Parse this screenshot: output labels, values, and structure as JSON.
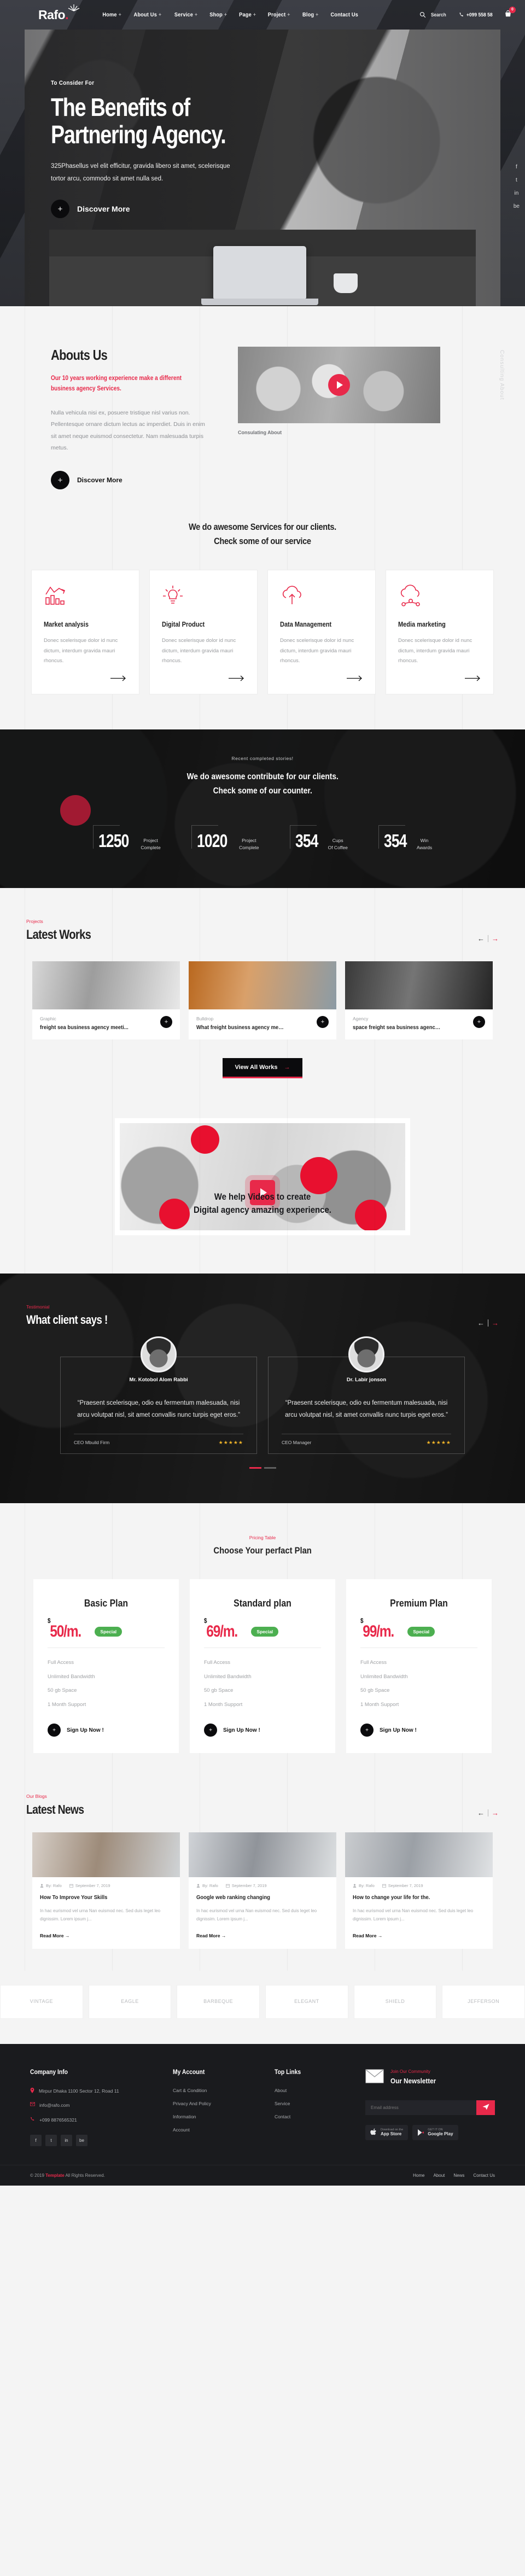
{
  "brand": {
    "name": "Rafo",
    "dot": ".",
    "accent": "#e8294a"
  },
  "header": {
    "nav": [
      {
        "label": "Home",
        "caret": "+"
      },
      {
        "label": "About Us",
        "caret": "+"
      },
      {
        "label": "Service",
        "caret": "+"
      },
      {
        "label": "Shop",
        "caret": "+"
      },
      {
        "label": "Page",
        "caret": "+"
      },
      {
        "label": "Project",
        "caret": "+"
      },
      {
        "label": "Blog",
        "caret": "+"
      },
      {
        "label": "Contact Us",
        "caret": ""
      }
    ],
    "search_label": "Search",
    "search_placeholder": "Search",
    "phone": "+099 558 58",
    "cart_count": "0",
    "side_links": [
      "f",
      "t",
      "in",
      "be"
    ]
  },
  "hero": {
    "subtitle": "To Consider For",
    "title_line1": "The Benefits of",
    "title_line2": "Partnering Agency.",
    "text": "325Phasellus vel elit efficitur, gravida libero sit amet, scelerisque tortor arcu, commodo sit amet nulla sed.",
    "cta": "Discover More",
    "cta_icon": "+"
  },
  "about": {
    "title": "Abouts Us",
    "tagline": "Our 10 years working experience make a different business agency Services.",
    "paragraph": "Nulla vehicula nisi ex, posuere tristique nisl varius non. Pellentesque ornare dictum lectus ac imperdiet. Duis in enim sit amet neque euismod consectetur. Nam malesuada turpis metus.",
    "cta": "Discover More",
    "cta_icon": "+",
    "video_caption": "Consulating About",
    "watermark": "Consulting About"
  },
  "services": {
    "heading_line1": "We do awesome Services for our clients.",
    "heading_line2": "Check some of our service",
    "cards": [
      {
        "icon": "bar-chart-icon",
        "title": "Market analysis",
        "text": "Donec scelerisque dolor id nunc dictum, interdum gravida mauri rhoncus."
      },
      {
        "icon": "lightbulb-icon",
        "title": "Digital Product",
        "text": "Donec scelerisque dolor id nunc dictum, interdum gravida mauri rhoncus."
      },
      {
        "icon": "cloud-upload-icon",
        "title": "Data Management",
        "text": "Donec scelerisque dolor id nunc dictum, interdum gravida mauri rhoncus."
      },
      {
        "icon": "cloud-network-icon",
        "title": "Media marketing",
        "text": "Donec scelerisque dolor id nunc dictum, interdum gravida mauri rhoncus."
      }
    ]
  },
  "counter": {
    "eyebrow": "Recent completed stories!",
    "heading_line1": "We do awesome contribute for our clients.",
    "heading_line2": "Check some of our counter.",
    "items": [
      {
        "value": "1250",
        "label_line1": "Project",
        "label_line2": "Complete"
      },
      {
        "value": "1020",
        "label_line1": "Project",
        "label_line2": "Complete"
      },
      {
        "value": "354",
        "label_line1": "Cups",
        "label_line2": "Of Coffee"
      },
      {
        "value": "354",
        "label_line1": "Win",
        "label_line2": "Awards"
      }
    ]
  },
  "works": {
    "eyebrow": "Projects",
    "title": "Latest Works",
    "prev_icon": "arrow-left-icon",
    "next_icon": "arrow-right-icon",
    "items": [
      {
        "category": "Graphic",
        "title": "freight sea business agency meeti...",
        "plus": "+"
      },
      {
        "category": "Bulldrop",
        "title": "What freight business agency meet...",
        "plus": "+"
      },
      {
        "category": "Agency",
        "title": "space freight sea business agency ...",
        "plus": "+"
      }
    ],
    "view_all": "View All Works",
    "view_all_arrow": "→"
  },
  "promo": {
    "headline_line1": "We help Videos to create",
    "headline_line2": "Digital agency amazing experience.",
    "play_icon": "play-icon"
  },
  "testimonial": {
    "eyebrow": "Testimonial",
    "title": "What client says !",
    "cards": [
      {
        "name": "Mr. Kotobol Alom Rabbi",
        "quote": "“Praesent scelerisque, odio eu fermentum malesuada, nisi arcu volutpat nisl, sit amet convallis nunc turpis eget eros.”",
        "role": "CEO Mbuild Firm",
        "stars": "★★★★★"
      },
      {
        "name": "Dr. Labir jonson",
        "quote": "“Praesent scelerisque, odio eu fermentum malesuada, nisi arcu volutpat nisl, sit amet convallis nunc turpis eget eros.”",
        "role": "CEO Manager",
        "stars": "★★★★★"
      }
    ]
  },
  "pricing": {
    "eyebrow": "Pricing Table",
    "title": "Choose Your perfact Plan",
    "plans": [
      {
        "name": "Basic Plan",
        "currency": "$",
        "price": "50/m.",
        "badge": "Special",
        "features": [
          "Full Access",
          "Unlimited Bandwidth",
          "50 gb Space",
          "1 Month Support"
        ],
        "cta": "Sign Up Now !",
        "cta_icon": "+"
      },
      {
        "name": "Standard plan",
        "currency": "$",
        "price": "69/m.",
        "badge": "Special",
        "features": [
          "Full Access",
          "Unlimited Bandwidth",
          "50 gb Space",
          "1 Month Support"
        ],
        "cta": "Sign Up Now !",
        "cta_icon": "+"
      },
      {
        "name": "Premium Plan",
        "currency": "$",
        "price": "99/m.",
        "badge": "Special",
        "features": [
          "Full Access",
          "Unlimited Bandwidth",
          "50 gb Space",
          "1 Month Support"
        ],
        "cta": "Sign Up Now !",
        "cta_icon": "+"
      }
    ]
  },
  "blog": {
    "eyebrow": "Our Blogs",
    "title": "Latest News",
    "prev_icon": "arrow-left-icon",
    "next_icon": "arrow-right-icon",
    "posts": [
      {
        "author": "By: Rafo",
        "date": "September 7, 2019",
        "title": "How To Improve Your Skills",
        "excerpt": "In hac eurismod vel urna Nan euismod nec. Sed duis leget leo dignissim. Lorem ipsum j...",
        "more": "Read More →"
      },
      {
        "author": "By: Rafo",
        "date": "September 7, 2019",
        "title": "Google web ranking changing",
        "excerpt": "In hac eurismod vel urna Nan euismod nec. Sed duis leget leo dignissim. Lorem ipsum j...",
        "more": "Read More →"
      },
      {
        "author": "By: Rafo",
        "date": "September 7, 2019",
        "title": "How to change your life for the.",
        "excerpt": "In hac eurismod vel urna Nan euismod nec. Sed duis leget leo dignissim. Lorem ipsum j...",
        "more": "Read More →"
      }
    ]
  },
  "brands": [
    {
      "name": "VINTAGE"
    },
    {
      "name": "EAGLE"
    },
    {
      "name": "BARBEQUE"
    },
    {
      "name": "ELEGANT"
    },
    {
      "name": "SHIELD"
    },
    {
      "name": "JEFFERSON"
    }
  ],
  "footer": {
    "col1_title": "Company Info",
    "col1_lines": [
      {
        "icon": "pin-icon",
        "text": "Mirpur Dhaka 1100 Sector 12, Road 11"
      },
      {
        "icon": "mail-icon",
        "text": "info@rafo.com"
      },
      {
        "icon": "phone-icon",
        "text": "+099 8876565321"
      }
    ],
    "socials": [
      "f",
      "t",
      "in",
      "be"
    ],
    "col2_title": "My Account",
    "col2_links": [
      "Cart & Condition",
      "Privacy And Policy",
      "Information",
      "Account"
    ],
    "col3_title": "Top Links",
    "col3_links": [
      "About",
      "Service",
      "Contact"
    ],
    "newsletter_eyebrow": "Join Our Community",
    "newsletter_title": "Our Newsletter",
    "newsletter_placeholder": "Email address",
    "newsletter_btn_icon": "send-icon",
    "stores": [
      {
        "small": "Download on the",
        "large": "App Store"
      },
      {
        "small": "GET IT ON",
        "large": "Google Play"
      }
    ],
    "copyright_pre": "© 2019 ",
    "copyright_brand": "Template",
    "copyright_post": " All Rights Reserved.",
    "bottom_nav": [
      "Home",
      "About",
      "News",
      "Contact Us"
    ]
  }
}
